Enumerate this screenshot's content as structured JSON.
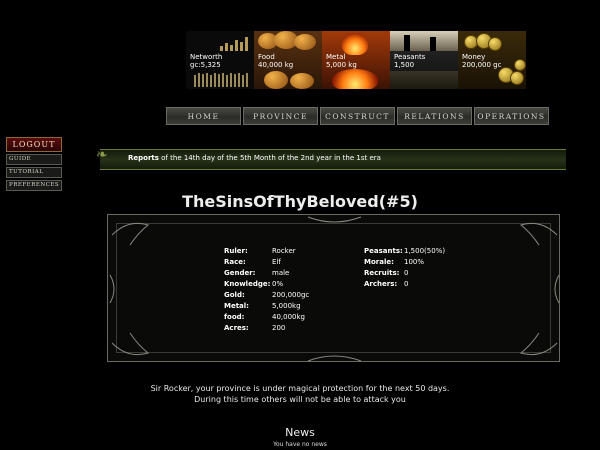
{
  "banner": {
    "networth": {
      "label": "Networth",
      "value": "gc:5,325"
    },
    "food": {
      "label": "Food",
      "value": "40,000 kg"
    },
    "metal": {
      "label": "Metal",
      "value": "5,000 kg"
    },
    "peasants": {
      "label": "Peasants",
      "value": "1,500"
    },
    "money": {
      "label": "Money",
      "value": "200,000 gc"
    }
  },
  "nav": {
    "home": "HOME",
    "province": "PROVINCE",
    "construct": "CONSTRUCT",
    "relations": "RELATIONS",
    "operations": "OPERATIONS"
  },
  "leftmenu": {
    "logout": "LOGOUT",
    "guide": "GUIDE",
    "tutorial": "TUTORIAL",
    "preferences": "PREFERENCES"
  },
  "report": {
    "label": "Reports",
    "text": "of the 14th day of the 5th Month of the 2nd year in the 1st era"
  },
  "province": {
    "title": "TheSinsOfThyBeloved(#5)"
  },
  "stats": {
    "ruler": {
      "label": "Ruler:",
      "value": "Rocker"
    },
    "race": {
      "label": "Race:",
      "value": "Elf"
    },
    "gender": {
      "label": "Gender:",
      "value": "male"
    },
    "knowledge": {
      "label": "Knowledge:",
      "value": "0%"
    },
    "gold": {
      "label": "Gold:",
      "value": "200,000gc"
    },
    "metal": {
      "label": "Metal:",
      "value": "5,000kg"
    },
    "food": {
      "label": "food:",
      "value": "40,000kg"
    },
    "acres": {
      "label": "Acres:",
      "value": "200"
    },
    "peasants": {
      "label": "Peasants:",
      "value": "1,500(50%)"
    },
    "morale": {
      "label": "Morale:",
      "value": "100%"
    },
    "recruits": {
      "label": "Recruits:",
      "value": "0"
    },
    "archers": {
      "label": "Archers:",
      "value": "0"
    }
  },
  "message": {
    "line1": "Sir Rocker, your province is under magical protection for the next 50 days.",
    "line2": "During this time others will not be able to attack you"
  },
  "news": {
    "heading": "News",
    "text": "You have no news"
  }
}
